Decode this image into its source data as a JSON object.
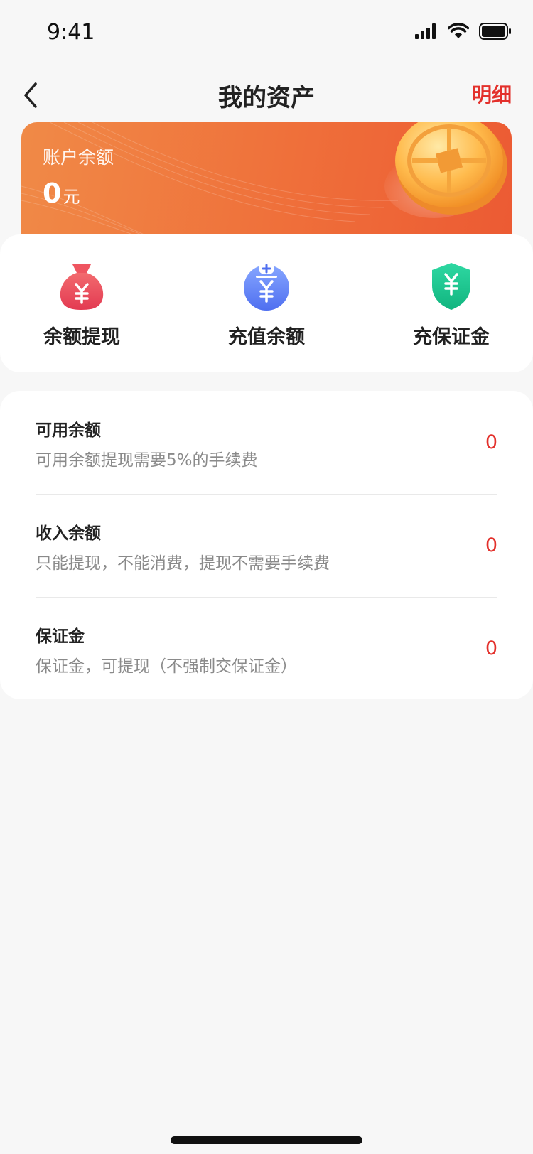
{
  "status_bar": {
    "time": "9:41"
  },
  "nav": {
    "title": "我的资产",
    "detail_label": "明细"
  },
  "balance_card": {
    "label": "账户余额",
    "value": "0",
    "unit": "元"
  },
  "actions": [
    {
      "label": "余额提现",
      "icon": "money-bag-icon"
    },
    {
      "label": "充值余额",
      "icon": "recharge-icon"
    },
    {
      "label": "充保证金",
      "icon": "shield-yuan-icon"
    }
  ],
  "balances": [
    {
      "title": "可用余额",
      "desc": "可用余额提现需要5%的手续费",
      "value": "0"
    },
    {
      "title": "收入余额",
      "desc": "只能提现，不能消费，提现不需要手续费",
      "value": "0"
    },
    {
      "title": "保证金",
      "desc": "保证金，可提现（不强制交保证金）",
      "value": "0"
    }
  ],
  "colors": {
    "accent": "#e3302b",
    "card_orange": "#ef6f3a",
    "bag_red": "#e8475a",
    "recharge_blue": "#5b7ef5",
    "shield_green": "#17c48a"
  }
}
